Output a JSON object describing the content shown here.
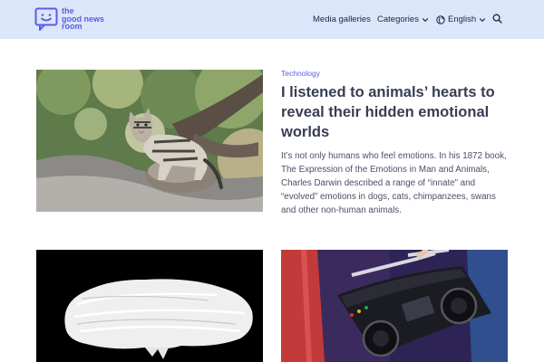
{
  "brand": {
    "line1": "the",
    "line2": "good news",
    "line3": "room",
    "color": "#5a5ce6"
  },
  "header": {
    "background": "#dbe6fb",
    "nav": {
      "galleries": "Media galleries",
      "categories": "Categories",
      "language": "English",
      "icons": [
        "chevron-down-icon",
        "globe-icon",
        "search-icon"
      ]
    }
  },
  "featured": {
    "category": "Technology",
    "title": "I listened to animals’ hearts to reveal their hidden emotional worlds",
    "excerpt": "It’s not only humans who feel emotions. In his 1872 book, The Expression of the Emotions in Man and Animals, Charles Darwin described a range of “innate” and “evolved” emotions in dogs, cats, chimpanzees, swans and other non-human animals."
  }
}
